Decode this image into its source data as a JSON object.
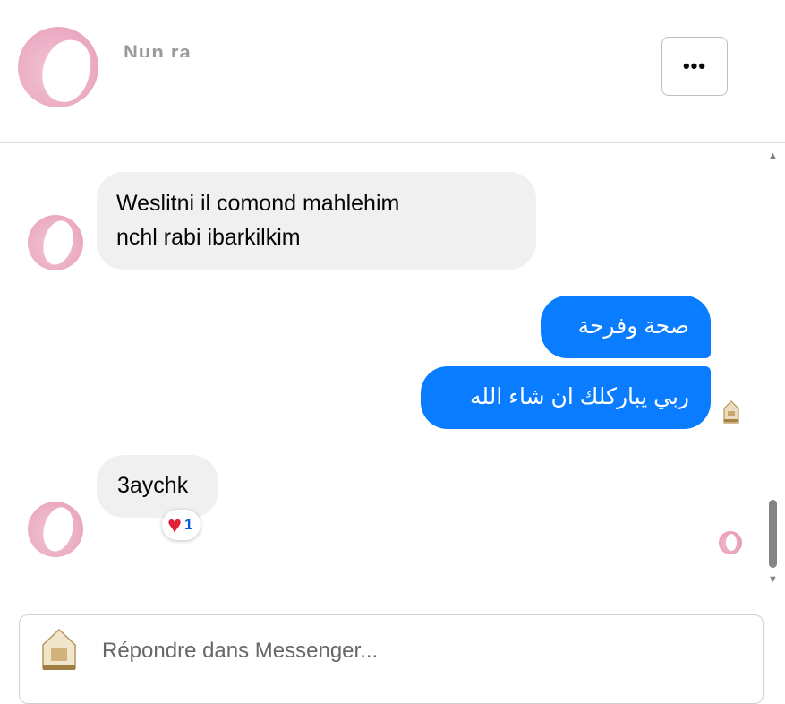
{
  "header": {
    "contact_name": "Nun ra",
    "more_label": "•••"
  },
  "messages": [
    {
      "direction": "in",
      "lines": [
        "Weslitni il comond mahlehim",
        "nchl rabi ibarkilkim"
      ]
    },
    {
      "direction": "out",
      "text": "صحة وفرحة"
    },
    {
      "direction": "out",
      "text": "ربي يباركلك ان شاء الله"
    },
    {
      "direction": "in",
      "text": "3aychk",
      "reaction": {
        "emoji": "❤️",
        "count": "1"
      }
    }
  ],
  "scrollbar": {
    "up_arrow": "▲",
    "down_arrow": "▼"
  },
  "composer": {
    "placeholder": "Répondre dans Messenger..."
  },
  "colors": {
    "outgoing_bubble": "#0a7cff",
    "incoming_bubble": "#f0f0f0",
    "heart": "#e0213a"
  }
}
